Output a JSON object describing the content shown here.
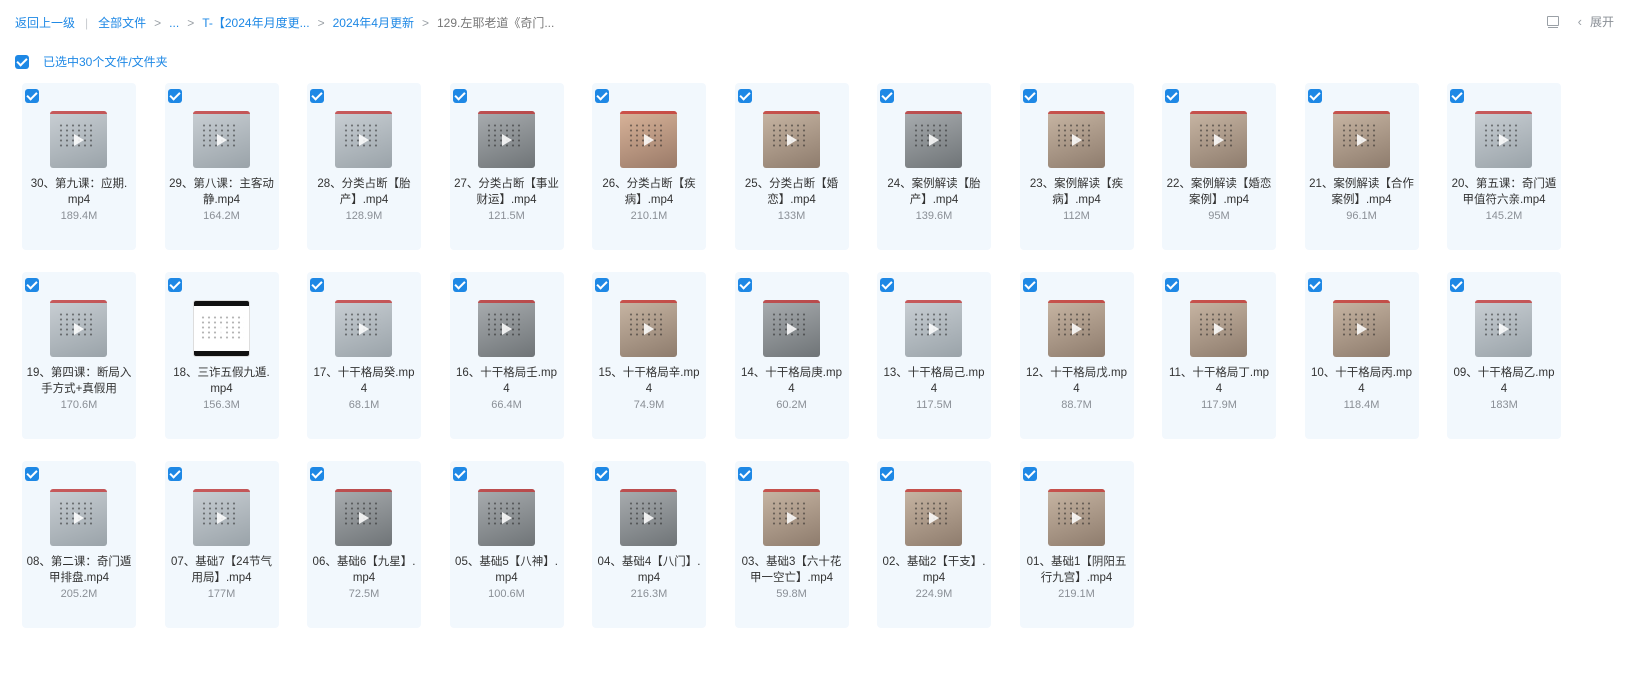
{
  "breadcrumb": {
    "back": "返回上一级",
    "all_files": "全部文件",
    "ellipsis": "...",
    "folder1": "T-【2024年月度更...",
    "folder2": "2024年4月更新",
    "current": "129.左耶老道《奇门..."
  },
  "toolbar": {
    "expand_label": "展开"
  },
  "selection": {
    "label": "已选中30个文件/文件夹",
    "checked": true
  },
  "files": [
    {
      "name": "30、第九课：应期.mp4",
      "size": "189.4M",
      "tone": "t-light"
    },
    {
      "name": "29、第八课：主客动静.mp4",
      "size": "164.2M",
      "tone": "t-light"
    },
    {
      "name": "28、分类占断【胎产】.mp4",
      "size": "128.9M",
      "tone": "t-light"
    },
    {
      "name": "27、分类占断【事业财运】.mp4",
      "size": "121.5M",
      "tone": "t-grey"
    },
    {
      "name": "26、分类占断【疾病】.mp4",
      "size": "210.1M",
      "tone": "t-peach"
    },
    {
      "name": "25、分类占断【婚恋】.mp4",
      "size": "133M",
      "tone": "t-warm"
    },
    {
      "name": "24、案例解读【胎产】.mp4",
      "size": "139.6M",
      "tone": "t-grey"
    },
    {
      "name": "23、案例解读【疾病】.mp4",
      "size": "112M",
      "tone": "t-warm"
    },
    {
      "name": "22、案例解读【婚恋案例】.mp4",
      "size": "95M",
      "tone": "t-warm"
    },
    {
      "name": "21、案例解读【合作案例】.mp4",
      "size": "96.1M",
      "tone": "t-warm"
    },
    {
      "name": "20、第五课：奇门遁甲值符六亲.mp4",
      "size": "145.2M",
      "tone": "t-light"
    },
    {
      "name": "19、第四课：断局入手方式+真假用",
      "size": "170.6M",
      "tone": "t-light"
    },
    {
      "name": "18、三诈五假九遁.mp4",
      "size": "156.3M",
      "tone": "t-paper"
    },
    {
      "name": "17、十干格局癸.mp4",
      "size": "68.1M",
      "tone": "t-light"
    },
    {
      "name": "16、十干格局壬.mp4",
      "size": "66.4M",
      "tone": "t-grey"
    },
    {
      "name": "15、十干格局辛.mp4",
      "size": "74.9M",
      "tone": "t-warm"
    },
    {
      "name": "14、十干格局庚.mp4",
      "size": "60.2M",
      "tone": "t-grey"
    },
    {
      "name": "13、十干格局己.mp4",
      "size": "117.5M",
      "tone": "t-light"
    },
    {
      "name": "12、十干格局戊.mp4",
      "size": "88.7M",
      "tone": "t-warm"
    },
    {
      "name": "11、十干格局丁.mp4",
      "size": "117.9M",
      "tone": "t-warm"
    },
    {
      "name": "10、十干格局丙.mp4",
      "size": "118.4M",
      "tone": "t-warm"
    },
    {
      "name": "09、十干格局乙.mp4",
      "size": "183M",
      "tone": "t-light"
    },
    {
      "name": "08、第二课：奇门遁甲排盘.mp4",
      "size": "205.2M",
      "tone": "t-light"
    },
    {
      "name": "07、基础7【24节气用局】.mp4",
      "size": "177M",
      "tone": "t-light"
    },
    {
      "name": "06、基础6【九星】.mp4",
      "size": "72.5M",
      "tone": "t-grey"
    },
    {
      "name": "05、基础5【八神】.mp4",
      "size": "100.6M",
      "tone": "t-grey"
    },
    {
      "name": "04、基础4【八门】.mp4",
      "size": "216.3M",
      "tone": "t-grey"
    },
    {
      "name": "03、基础3【六十花甲一空亡】.mp4",
      "size": "59.8M",
      "tone": "t-warm"
    },
    {
      "name": "02、基础2【干支】.mp4",
      "size": "224.9M",
      "tone": "t-warm"
    },
    {
      "name": "01、基础1【阴阳五行九宫】.mp4",
      "size": "219.1M",
      "tone": "t-warm"
    }
  ]
}
